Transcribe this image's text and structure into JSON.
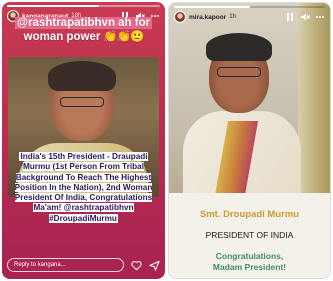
{
  "left_story": {
    "username": "kanganaranaut",
    "time": "18h",
    "progress": 0.6,
    "caption_line1": "@rashtrapatibhvn ah for",
    "caption_line2": "woman power",
    "caption_emojis": "👏👏🙂",
    "quote": "India's 15th President - Draupadi Murmu (1st Person From Tribal Background To Reach The Highest Position In the Nation), 2nd Woman President Of India, Congratulations Ma'am! @rashtrapatibhvn #DroupadiMurmu",
    "reply_placeholder": "Reply to kangana..."
  },
  "right_story": {
    "username": "mira.kapoor",
    "time": "1h",
    "progress": 0.5,
    "name": "Smt. Droupadi Murmu",
    "title": "PRESIDENT OF INDIA",
    "congrats_line1": "Congratulations,",
    "congrats_line2": "Madam President!"
  },
  "colors": {
    "left_background": "#b52c50",
    "quote_text": "#2a1a5e",
    "name_gold": "#c99a2e",
    "congrats_green": "#3f8f6a"
  },
  "icons": [
    "pause-icon",
    "mute-icon",
    "more-icon",
    "heart-icon",
    "send-icon"
  ]
}
